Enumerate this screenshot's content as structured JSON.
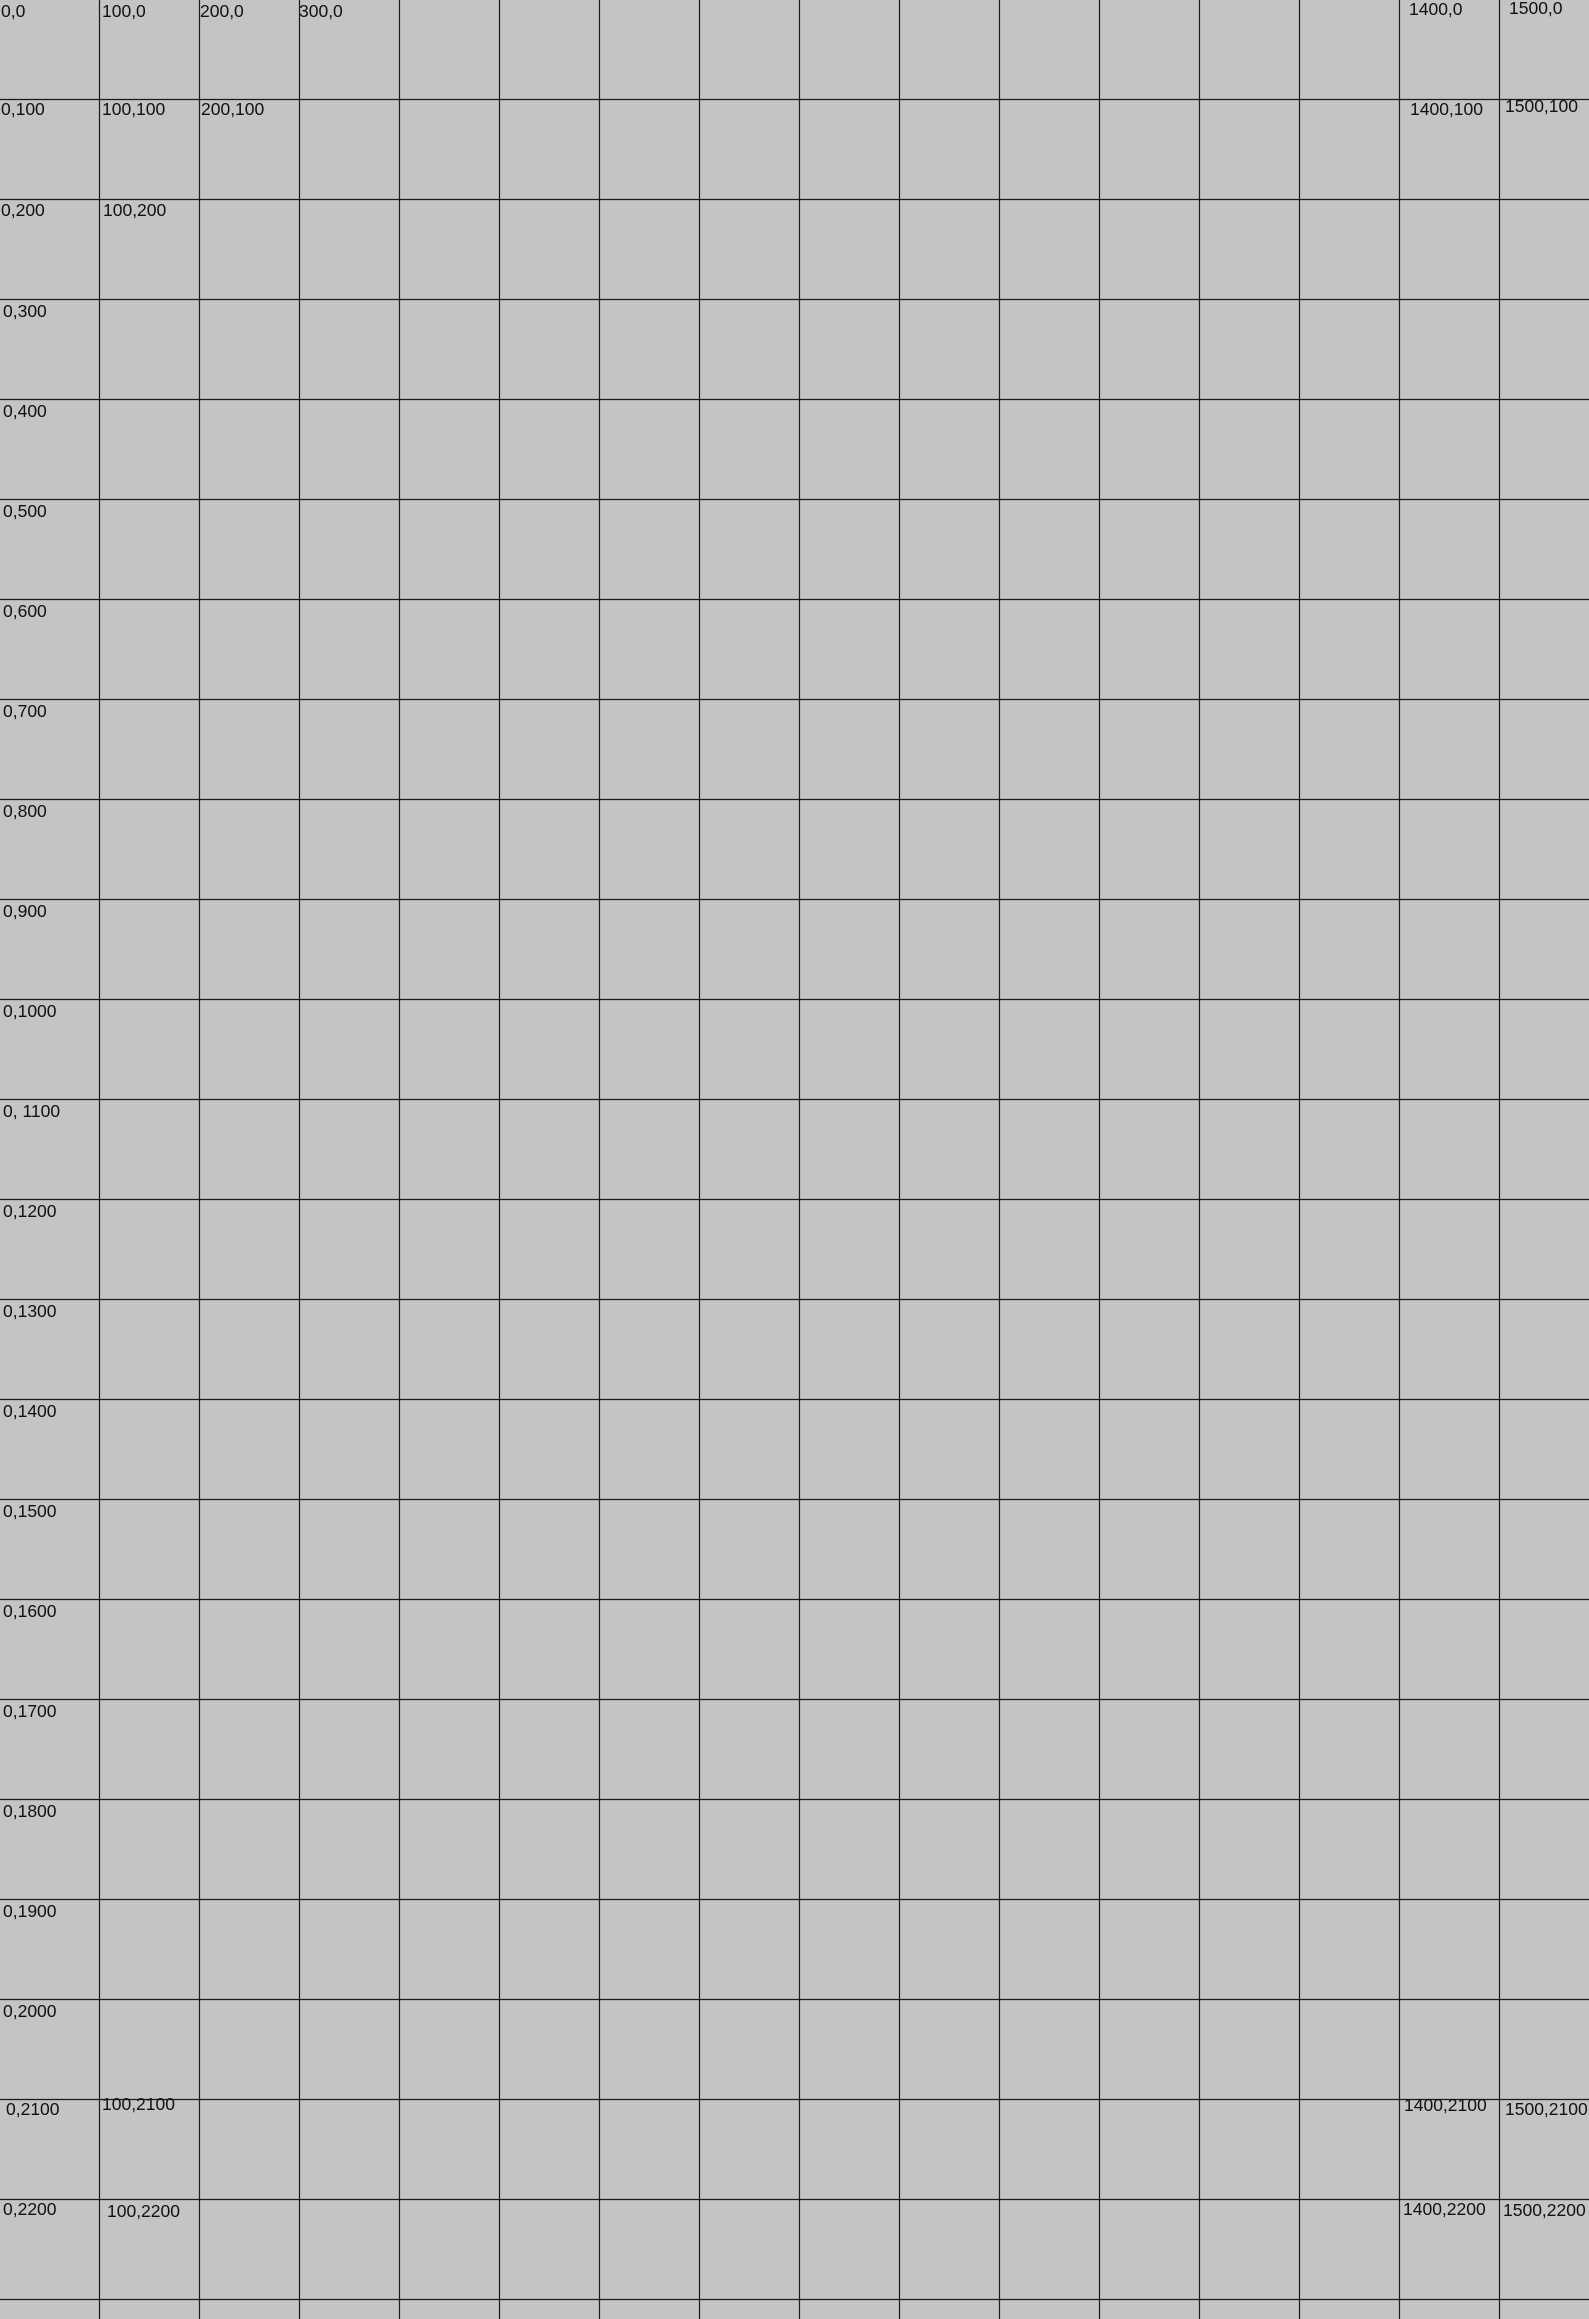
{
  "colors": {
    "background": "#c4c4c4",
    "grid_line": "#1a1a1a",
    "label_text": "#111111"
  },
  "grid": {
    "columns": 16,
    "rows": 24
  },
  "labels": [
    {
      "text": "0,0"
    },
    {
      "text": "100,0"
    },
    {
      "text": "200,0"
    },
    {
      "text": "300,0"
    },
    {
      "text": "1400,0"
    },
    {
      "text": "1500,0"
    },
    {
      "text": "0,100"
    },
    {
      "text": "100,100"
    },
    {
      "text": "200,100"
    },
    {
      "text": "1400,100"
    },
    {
      "text": "1500,100"
    },
    {
      "text": "0,200"
    },
    {
      "text": "100,200"
    },
    {
      "text": "0,300"
    },
    {
      "text": "0,400"
    },
    {
      "text": "0,500"
    },
    {
      "text": "0,600"
    },
    {
      "text": "0,700"
    },
    {
      "text": "0,800"
    },
    {
      "text": "0,900"
    },
    {
      "text": "0,1000"
    },
    {
      "text": "0, 1100"
    },
    {
      "text": "0,1200"
    },
    {
      "text": "0,1300"
    },
    {
      "text": "0,1400"
    },
    {
      "text": "0,1500"
    },
    {
      "text": "0,1600"
    },
    {
      "text": "0,1700"
    },
    {
      "text": "0,1800"
    },
    {
      "text": "0,1900"
    },
    {
      "text": "0,2000"
    },
    {
      "text": "0,2100"
    },
    {
      "text": "100,2100"
    },
    {
      "text": "1400,2100"
    },
    {
      "text": "1500,2100"
    },
    {
      "text": "0,2200"
    },
    {
      "text": "100,2200"
    },
    {
      "text": "1400,2200"
    },
    {
      "text": "1500,2200"
    }
  ]
}
